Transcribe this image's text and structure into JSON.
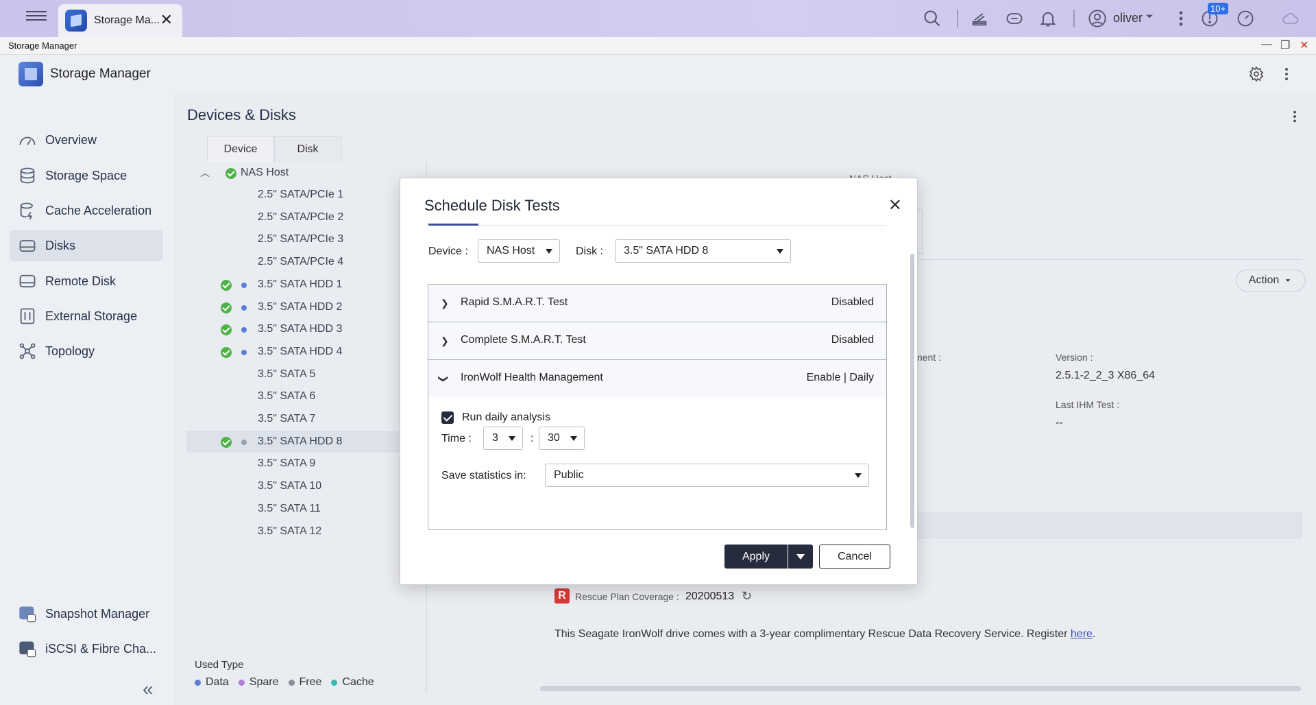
{
  "topbar": {
    "tab_label": "Storage Ma...",
    "user_name": "oliver",
    "notification_badge": "10+"
  },
  "window": {
    "title": "Storage Manager"
  },
  "app": {
    "title": "Storage Manager"
  },
  "sidebar": {
    "items": [
      {
        "label": "Overview",
        "icon": "gauge-icon"
      },
      {
        "label": "Storage Space",
        "icon": "database-icon"
      },
      {
        "label": "Cache Acceleration",
        "icon": "cache-icon"
      },
      {
        "label": "Disks",
        "icon": "disk-icon"
      },
      {
        "label": "Remote Disk",
        "icon": "remote-disk-icon"
      },
      {
        "label": "External Storage",
        "icon": "external-storage-icon"
      },
      {
        "label": "Topology",
        "icon": "topology-icon"
      }
    ],
    "bottom_items": [
      {
        "label": "Snapshot Manager"
      },
      {
        "label": "iSCSI & Fibre Cha..."
      }
    ],
    "active_index": 3
  },
  "main": {
    "title": "Devices & Disks",
    "tabs": [
      "Device",
      "Disk"
    ],
    "tree": {
      "root": "NAS Host",
      "items": [
        {
          "label": "2.5\" SATA/PCIe 1",
          "ok": false,
          "dot": ""
        },
        {
          "label": "2.5\" SATA/PCIe 2",
          "ok": false,
          "dot": ""
        },
        {
          "label": "2.5\" SATA/PCIe 3",
          "ok": false,
          "dot": ""
        },
        {
          "label": "2.5\" SATA/PCIe 4",
          "ok": false,
          "dot": ""
        },
        {
          "label": "3.5\" SATA HDD 1",
          "ok": true,
          "dot": "#5b7fd6"
        },
        {
          "label": "3.5\" SATA HDD 2",
          "ok": true,
          "dot": "#5b7fd6"
        },
        {
          "label": "3.5\" SATA HDD 3",
          "ok": true,
          "dot": "#5b7fd6"
        },
        {
          "label": "3.5\" SATA HDD 4",
          "ok": true,
          "dot": "#5b7fd6"
        },
        {
          "label": "3.5\" SATA 5",
          "ok": false,
          "dot": ""
        },
        {
          "label": "3.5\" SATA 6",
          "ok": false,
          "dot": ""
        },
        {
          "label": "3.5\" SATA 7",
          "ok": false,
          "dot": ""
        },
        {
          "label": "3.5\" SATA HDD 8",
          "ok": true,
          "dot": "#9aa0aa"
        },
        {
          "label": "3.5\" SATA 9",
          "ok": false,
          "dot": ""
        },
        {
          "label": "3.5\" SATA 10",
          "ok": false,
          "dot": ""
        },
        {
          "label": "3.5\" SATA 11",
          "ok": false,
          "dot": ""
        },
        {
          "label": "3.5\" SATA 12",
          "ok": false,
          "dot": ""
        }
      ],
      "selected_index": 11
    },
    "used_type": {
      "title": "Used Type",
      "items": [
        {
          "label": "Data",
          "color": "#5b7fd6"
        },
        {
          "label": "Spare",
          "color": "#b07fd8"
        },
        {
          "label": "Free",
          "color": "#8a8f98"
        },
        {
          "label": "Cache",
          "color": "#3bb7b3"
        }
      ]
    },
    "detail": {
      "nas_label": "NAS Host",
      "action_label": "Action",
      "management_label": "ment :",
      "version_label": "Version :",
      "version_value": "2.5.1-2_2_3 X86_64",
      "last_ihm_label": "Last IHM Test :",
      "last_ihm_value": "--",
      "rescue_label": "Rescue Plan Coverage :",
      "rescue_value": "20200513",
      "promo_text": "This Seagate IronWolf drive comes with a 3-year complimentary Rescue Data Recovery Service. Register ",
      "promo_link": "here",
      "promo_end": "."
    }
  },
  "dialog": {
    "title": "Schedule Disk Tests",
    "device_label": "Device :",
    "device_value": "NAS Host",
    "disk_label": "Disk :",
    "disk_value": "3.5\" SATA HDD 8",
    "tests": [
      {
        "title": "Rapid S.M.A.R.T. Test",
        "status": "Disabled",
        "expanded": false
      },
      {
        "title": "Complete S.M.A.R.T. Test",
        "status": "Disabled",
        "expanded": false
      },
      {
        "title": "IronWolf Health Management",
        "status": "Enable | Daily",
        "expanded": true
      }
    ],
    "run_daily_label": "Run daily analysis",
    "run_daily_checked": true,
    "time_label": "Time :",
    "hour": "3",
    "minute": "30",
    "time_sep": ":",
    "save_stats_label": "Save statistics in:",
    "save_stats_value": "Public",
    "apply_label": "Apply",
    "cancel_label": "Cancel"
  }
}
